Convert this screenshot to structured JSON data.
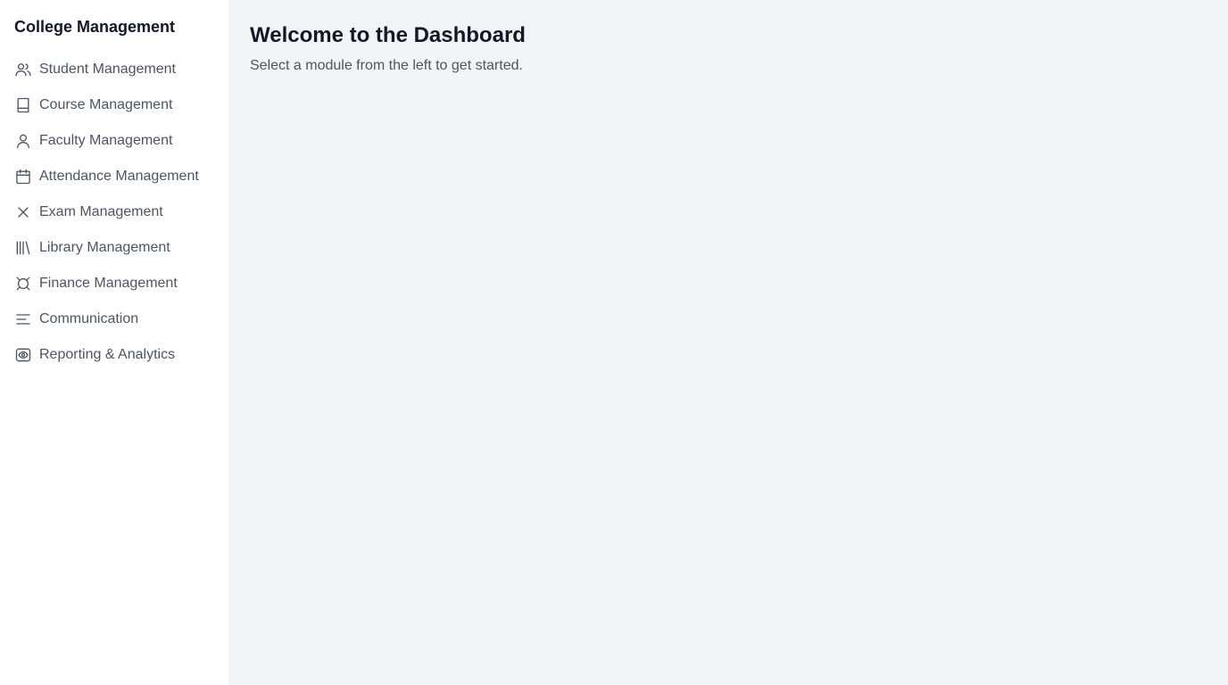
{
  "sidebar": {
    "title": "College Management",
    "items": [
      {
        "label": "Student Management",
        "icon": "users-icon"
      },
      {
        "label": "Course Management",
        "icon": "book-icon"
      },
      {
        "label": "Faculty Management",
        "icon": "user-icon"
      },
      {
        "label": "Attendance Management",
        "icon": "calendar-icon"
      },
      {
        "label": "Exam Management",
        "icon": "x-icon"
      },
      {
        "label": "Library Management",
        "icon": "library-icon"
      },
      {
        "label": "Finance Management",
        "icon": "currency-icon"
      },
      {
        "label": "Communication",
        "icon": "menu-lines-icon"
      },
      {
        "label": "Reporting & Analytics",
        "icon": "eye-icon"
      }
    ]
  },
  "main": {
    "title": "Welcome to the Dashboard",
    "subtitle": "Select a module from the left to get started."
  },
  "colors": {
    "sidebar_bg": "#ffffff",
    "main_bg": "#f3f4f6",
    "text_primary": "#111827",
    "text_secondary": "#4b5563"
  }
}
